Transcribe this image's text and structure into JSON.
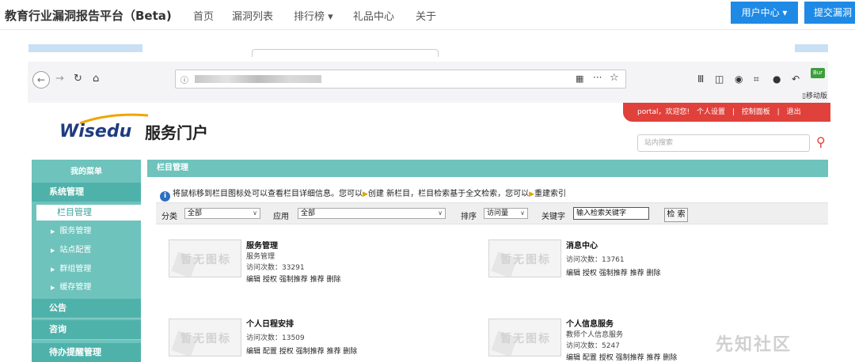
{
  "site": {
    "title": "教育行业漏洞报告平台（Beta)",
    "nav": [
      "首页",
      "漏洞列表",
      "排行榜 ▾",
      "礼品中心",
      "关于"
    ],
    "user_center": "用户中心 ▾",
    "submit_vuln": "提交漏洞"
  },
  "browser": {
    "back_icon": "arrow-left-icon",
    "mobile_label": "▯移动版",
    "badge": "Bur"
  },
  "portal": {
    "logo": "Wisedu",
    "name": "服务门户",
    "user_bar": [
      "portal，欢迎您!",
      "个人设置",
      "|",
      "控制面板",
      "|",
      "退出"
    ],
    "search_placeholder": "站内搜索"
  },
  "sidebar": {
    "my_menu": "我的菜单",
    "system_mgmt": "系统管理",
    "active_item": "栏目管理",
    "subs": [
      "服务管理",
      "站点配置",
      "群组管理",
      "缓存管理"
    ],
    "announce": "公告",
    "consult": "咨询",
    "todo": "待办提醒管理"
  },
  "panel": {
    "title": "栏目管理",
    "info_a": "将鼠标移到栏目图标处可以查看栏目详细信息。您可以",
    "info_create": "创建 新栏目，栏目检索基于全文检索，您可以",
    "info_reindex": "重建索引"
  },
  "filter": {
    "category_label": "分类",
    "category_value": "全部",
    "app_label": "应用",
    "app_value": "全部",
    "sort_label": "排序",
    "sort_value": "访问量",
    "keyword_label": "关键字",
    "keyword_value": "输入检索关键字",
    "search_btn": "检 索"
  },
  "cards": [
    {
      "placeholder": "暂无图标",
      "title": "服务管理",
      "lines": [
        "服务管理",
        "访问次数：33291"
      ],
      "actions": "编辑 授权 强制推荐 推荐 删除"
    },
    {
      "placeholder": "暂无图标",
      "title": "消息中心",
      "lines": [
        "访问次数：13761"
      ],
      "actions": "编辑 授权 强制推荐 推荐 删除"
    },
    {
      "placeholder": "暂无图标",
      "title": "个人日程安排",
      "lines": [
        "访问次数：13509"
      ],
      "actions": "编辑 配置 授权 强制推荐 推荐 删除"
    },
    {
      "placeholder": "暂无图标",
      "title": "个人信息服务",
      "lines": [
        "教师个人信息服务",
        "访问次数：5247"
      ],
      "actions": "编辑 配置 授权 强制推荐 推荐 删除"
    }
  ],
  "watermark": "先知社区",
  "colors": {
    "accent_teal": "#6ec3bc",
    "accent_red": "#e0413b",
    "accent_blue": "#1e8ae6"
  }
}
